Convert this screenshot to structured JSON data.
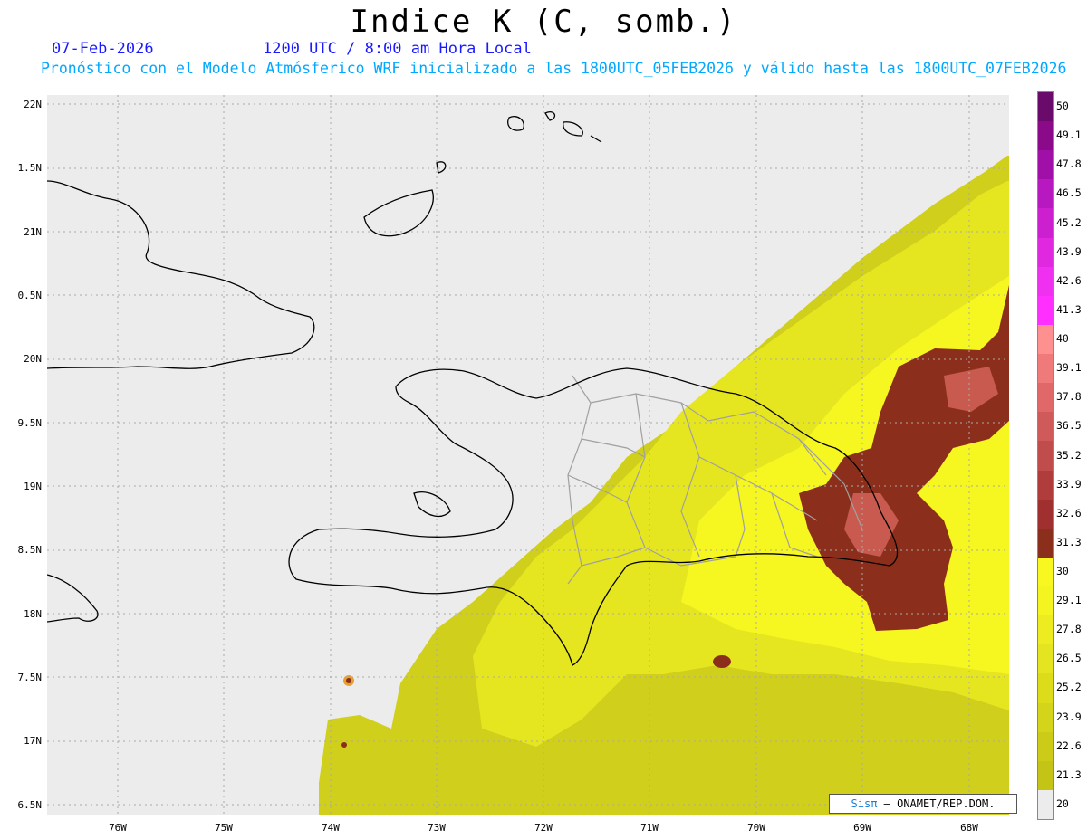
{
  "header": {
    "title": "Indice K (C, somb.)",
    "date": "07-Feb-2026",
    "time": "1200 UTC / 8:00 am Hora Local",
    "forecast": "Pronóstico con el Modelo Atmósferico WRF inicializado a las 1800UTC_05FEB2026 y válido hasta las  1800UTC_07FEB2026"
  },
  "axes": {
    "lat_labels": [
      "22N",
      "1.5N",
      "21N",
      "0.5N",
      "20N",
      "9.5N",
      "19N",
      "8.5N",
      "18N",
      "7.5N",
      "17N",
      "6.5N"
    ],
    "lon_labels": [
      "76W",
      "75W",
      "74W",
      "73W",
      "72W",
      "71W",
      "70W",
      "69W",
      "68W"
    ]
  },
  "colorbar": {
    "labels": [
      "50",
      "49.1",
      "47.8",
      "46.5",
      "45.2",
      "43.9",
      "42.6",
      "41.3",
      "40",
      "39.1",
      "37.8",
      "36.5",
      "35.2",
      "33.9",
      "32.6",
      "31.3",
      "30",
      "29.1",
      "27.8",
      "26.5",
      "25.2",
      "23.9",
      "22.6",
      "21.3",
      "20"
    ],
    "colors": [
      "#6a0a6a",
      "#8a0a8a",
      "#a010a8",
      "#b818c0",
      "#cc20d0",
      "#e028e0",
      "#f030f0",
      "#ff30ff",
      "#ff9090",
      "#f07a7a",
      "#e06868",
      "#d05a5a",
      "#c04c4c",
      "#b03c3c",
      "#a03030",
      "#8c2e1c",
      "#f8f820",
      "#f4f420",
      "#ecec20",
      "#e4e420",
      "#dcdc1a",
      "#d4d41a",
      "#cccc18",
      "#c4c416",
      "#ececec"
    ]
  },
  "credit": {
    "logo": "Sisπ",
    "text": " – ONAMET/REP.DOM."
  },
  "colors": {
    "background_nodata": "#ececec",
    "coast": "#000000",
    "province_borders": "#a0a0a0",
    "grid": "#aaaaaa"
  }
}
